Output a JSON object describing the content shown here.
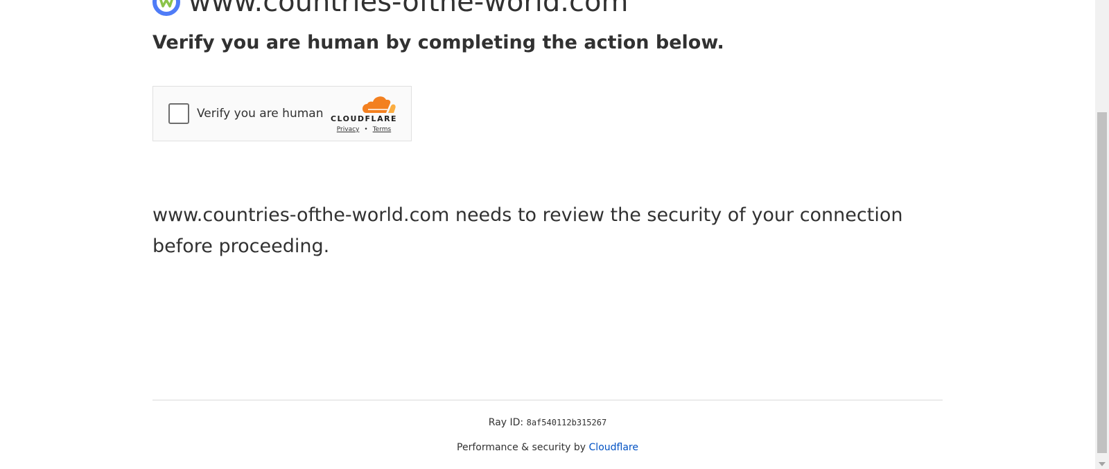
{
  "header": {
    "site_title": "www.countries-ofthe-world.com",
    "logo_icon": "site-logo-icon",
    "subtitle": "Verify you are human by completing the action below."
  },
  "challenge": {
    "checkbox_label": "Verify you are human",
    "brand": "CLOUDFLARE",
    "privacy_link": "Privacy",
    "separator": "•",
    "terms_link": "Terms",
    "brand_color": "#f38020"
  },
  "message": {
    "text": "www.countries-ofthe-world.com needs to review the security of your connection before proceeding."
  },
  "footer": {
    "ray_label": "Ray ID:",
    "ray_id": "8af540112b315267",
    "performance_text": "Performance & security by",
    "performance_link": "Cloudflare",
    "link_color": "#0051c3"
  }
}
